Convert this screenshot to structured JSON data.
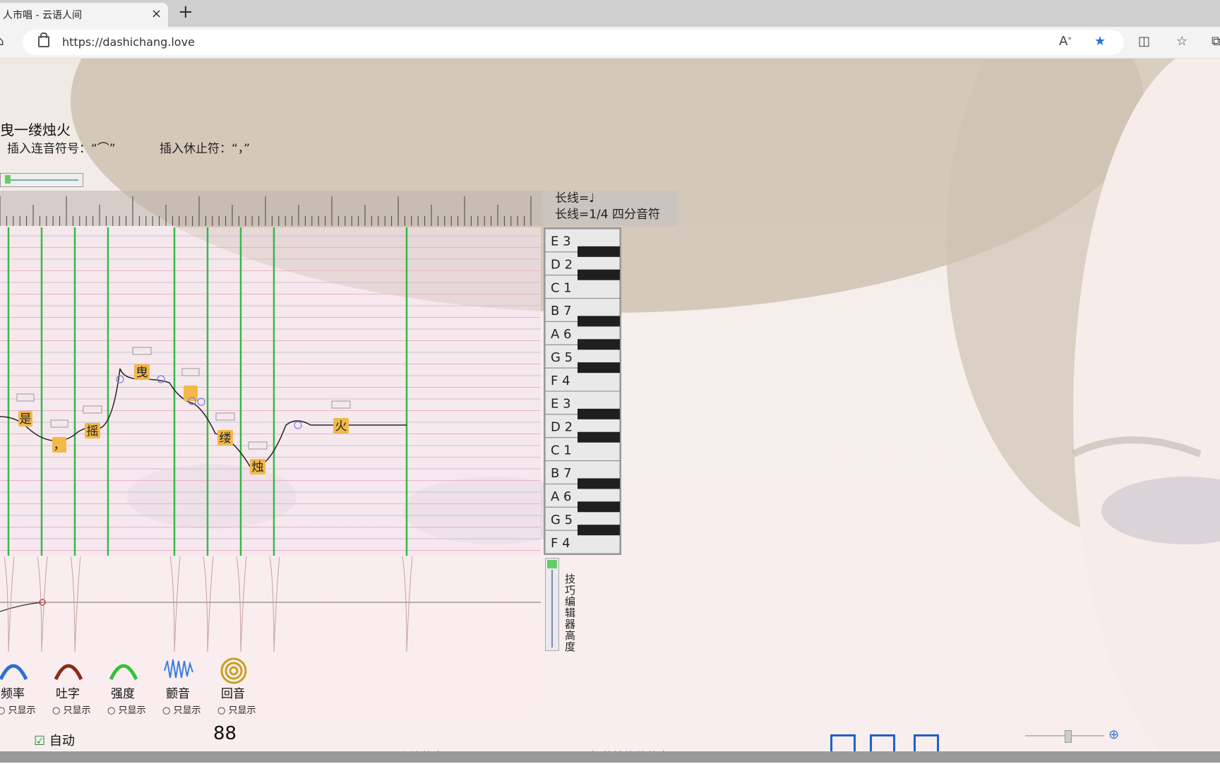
{
  "browser": {
    "tab_title": "人市唱 - 云语人间",
    "close_glyph": "×",
    "new_tab_glyph": "+",
    "url": "https://dashichang.love"
  },
  "song": {
    "title": "曳一缕烛火",
    "hint_link": "插入连音符号：“⌒”",
    "hint_rest": "插入休止符：“，”"
  },
  "length_info": {
    "line1": "长线=♩",
    "line2": "长线=1/4 四分音符"
  },
  "keys": [
    {
      "note": "E",
      "num": "3"
    },
    {
      "note": "D",
      "num": "2"
    },
    {
      "note": "C",
      "num": "1"
    },
    {
      "note": "B",
      "num": "7"
    },
    {
      "note": "A",
      "num": "6"
    },
    {
      "note": "G",
      "num": "5"
    },
    {
      "note": "F",
      "num": "4"
    },
    {
      "note": "E",
      "num": "3"
    },
    {
      "note": "D",
      "num": "2"
    },
    {
      "note": "C",
      "num": "1"
    },
    {
      "note": "B",
      "num": "7"
    },
    {
      "note": "A",
      "num": "6"
    },
    {
      "note": "G",
      "num": "5"
    },
    {
      "note": "F",
      "num": "4"
    }
  ],
  "lyric_notes": [
    "是",
    "，",
    "摇",
    "曳",
    "",
    "缕",
    "烛",
    "火"
  ],
  "tools": [
    {
      "label": "频率",
      "radio": "只显示",
      "color": "#2a6fd6"
    },
    {
      "label": "吐字",
      "radio": "只显示",
      "color": "#8b2a18"
    },
    {
      "label": "强度",
      "radio": "只显示",
      "color": "#35c23a"
    },
    {
      "label": "颤音",
      "radio": "只显示",
      "color": "#3a7fe0"
    },
    {
      "label": "回音",
      "radio": "只显示",
      "color": "#c9a020"
    }
  ],
  "side_slider_label": "技巧编辑器高度",
  "auto_label": "自动",
  "bpm": "88",
  "bottom_texts": [
    "主旋律音量",
    "打节拍旋律的音量"
  ]
}
